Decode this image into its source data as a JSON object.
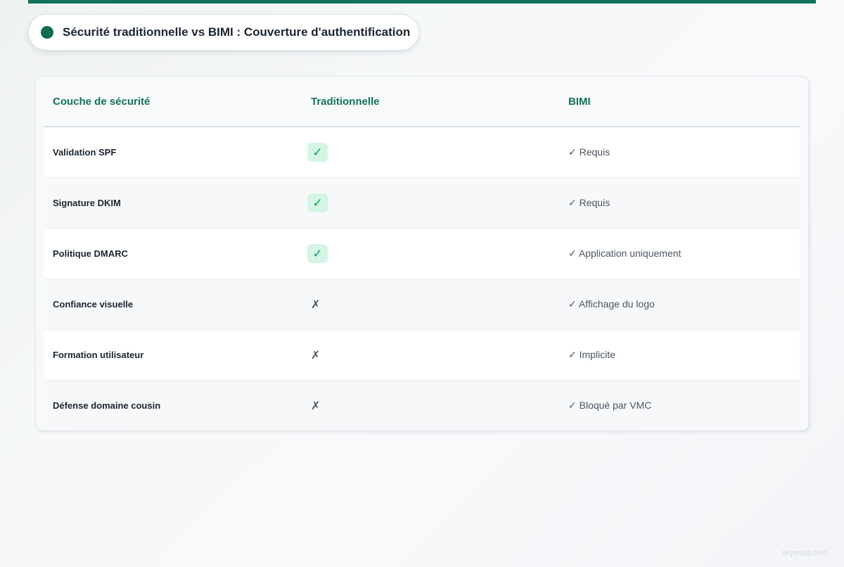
{
  "colors": {
    "accent": "#13735a",
    "check_bg": "#d5f5e4",
    "check_fg": "#0e9a62"
  },
  "title": {
    "icon": "status-dot-icon",
    "text": "Sécurité traditionnelle vs BIMI : Couverture d'authentification"
  },
  "table": {
    "headers": {
      "layer": "Couche de sécurité",
      "traditional": "Traditionnelle",
      "bimi": "BIMI"
    },
    "rows": [
      {
        "layer": "Validation SPF",
        "traditional": "✓",
        "traditional_icon": "check-icon",
        "bimi": "✓ Requis"
      },
      {
        "layer": "Signature DKIM",
        "traditional": "✓",
        "traditional_icon": "check-icon",
        "bimi": "✓ Requis"
      },
      {
        "layer": "Politique DMARC",
        "traditional": "✓",
        "traditional_icon": "check-icon",
        "bimi": "✓ Application uniquement"
      },
      {
        "layer": "Confiance visuelle",
        "traditional": "✗",
        "traditional_icon": "cross-icon",
        "bimi": "✓ Affichage du logo"
      },
      {
        "layer": "Formation utilisateur",
        "traditional": "✗",
        "traditional_icon": "cross-icon",
        "bimi": "✓ Implicite"
      },
      {
        "layer": "Défense domaine cousin",
        "traditional": "✗",
        "traditional_icon": "cross-icon",
        "bimi": "✓ Bloqué par VMC"
      }
    ]
  },
  "watermark": "skysnag.com"
}
